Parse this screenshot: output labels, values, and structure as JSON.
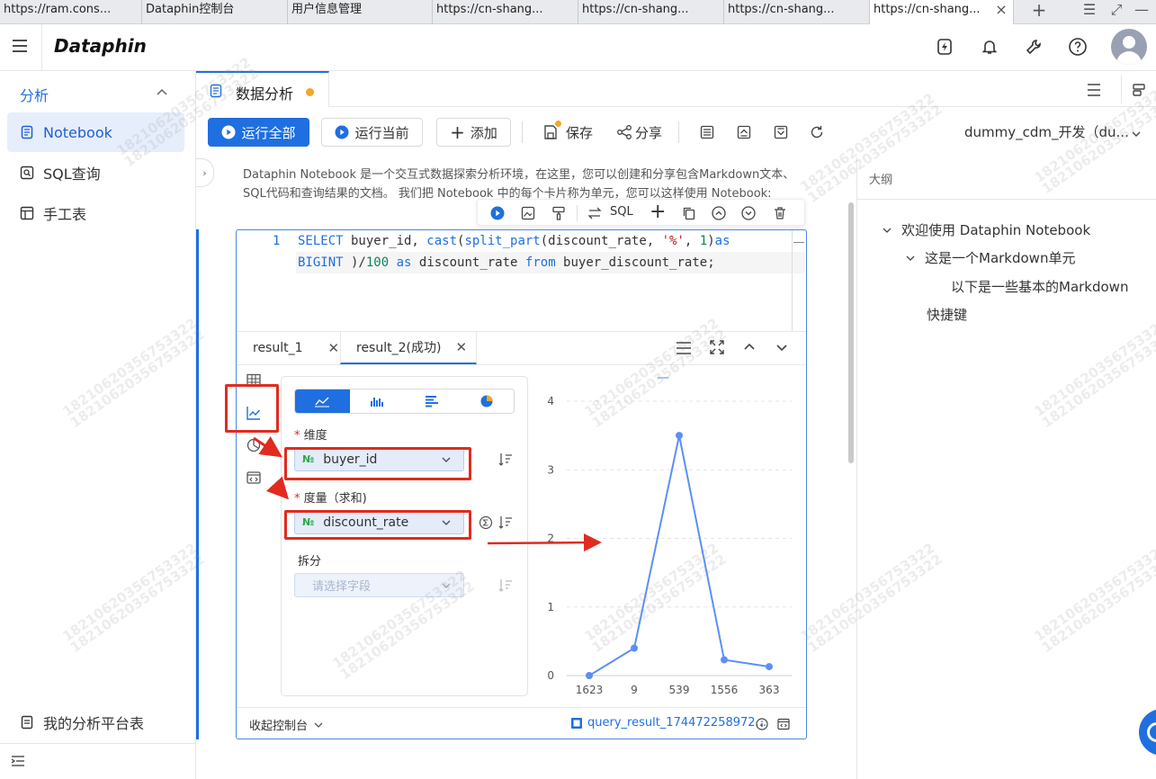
{
  "browser_tabs": [
    {
      "label": "https://ram.cons..."
    },
    {
      "label": "Dataphin控制台"
    },
    {
      "label": "用户信息管理"
    },
    {
      "label": "https://cn-shang..."
    },
    {
      "label": "https://cn-shang..."
    },
    {
      "label": "https://cn-shang..."
    },
    {
      "label": "https://cn-shang..."
    }
  ],
  "header": {
    "logo": "Dataphin"
  },
  "sidebar": {
    "section": "分析",
    "items": [
      {
        "label": "Notebook",
        "active": true,
        "icon": "notebook-icon"
      },
      {
        "label": "SQL查询",
        "icon": "sql-query-icon"
      },
      {
        "label": "手工表",
        "icon": "table-icon"
      }
    ],
    "bottom_item": "我的分析平台表"
  },
  "doc_tab": {
    "title": "数据分析"
  },
  "toolbar": {
    "run_all": "运行全部",
    "run_current": "运行当前",
    "add": "添加",
    "save": "保存",
    "share": "分享",
    "env": "dummy_cdm_开发（du..."
  },
  "intro": {
    "line1": "Dataphin Notebook 是一个交互式数据探索分析环境，在这里，您可以创建和分享包含Markdown文本、",
    "line2": "SQL代码和查询结果的文档。 我们把 Notebook 中的每个卡片称为单元，您可以这样使用 Notebook:"
  },
  "cell_toolbar": {
    "sql": "SQL"
  },
  "code": {
    "line_number": "1",
    "line1": "SELECT buyer_id, cast(split_part(discount_rate, '%', 1)as",
    "line2": "BIGINT )/100 as discount_rate from buyer_discount_rate;"
  },
  "results": {
    "tab1": "result_1",
    "tab2": "result_2(成功)"
  },
  "chart_config": {
    "dimension_label": "维度",
    "dimension_field": "buyer_id",
    "measure_label": "度量（求和)",
    "measure_field": "discount_rate",
    "split_label": "拆分",
    "split_placeholder": "请选择字段",
    "field_type_badge": "№"
  },
  "footer": {
    "collapse": "收起控制台",
    "query_result": "query_result_174472258972..."
  },
  "outline": {
    "title": "大纲",
    "items": [
      {
        "label": "欢迎使用 Dataphin Notebook"
      },
      {
        "label": "这是一个Markdown单元"
      },
      {
        "label": "以下是一些基本的Markdown"
      },
      {
        "label": "快捷键"
      }
    ]
  },
  "watermark": "18210620356753322",
  "colors": {
    "accent": "#1f6fe0",
    "line": "#5b8ff9",
    "annotation": "#e02b20"
  },
  "chart_data": {
    "type": "line",
    "categories": [
      "1623",
      "9",
      "539",
      "1556",
      "363"
    ],
    "values": [
      0,
      0.4,
      3.5,
      0.23,
      0.13
    ],
    "yticks": [
      "0",
      "1",
      "2",
      "3",
      "4"
    ],
    "ylim": [
      0,
      4
    ],
    "legend": "—",
    "grid": true
  }
}
